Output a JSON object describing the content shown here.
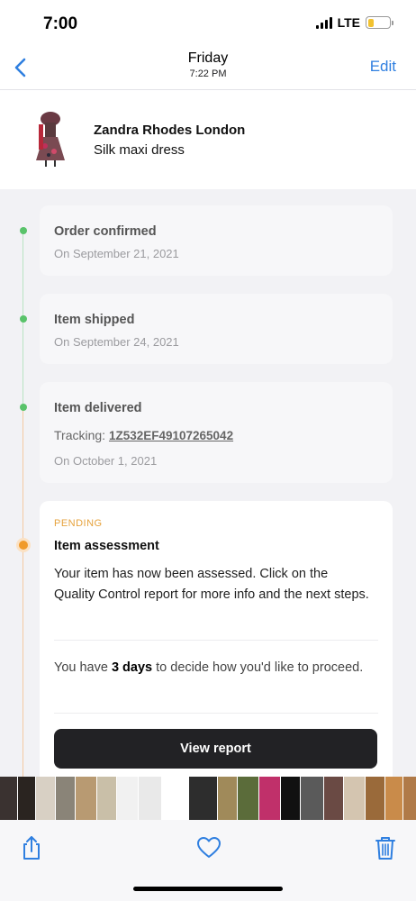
{
  "status_bar": {
    "time": "7:00",
    "network": "LTE"
  },
  "nav": {
    "title": "Friday",
    "subtitle": "7:22 PM",
    "edit_label": "Edit"
  },
  "product": {
    "brand": "Zandra Rhodes London",
    "name": "Silk maxi dress"
  },
  "timeline": {
    "order_confirmed": {
      "title": "Order confirmed",
      "date": "On September 21, 2021"
    },
    "item_shipped": {
      "title": "Item shipped",
      "date": "On September 24, 2021"
    },
    "item_delivered": {
      "title": "Item delivered",
      "tracking_label": "Tracking:",
      "tracking_number": "1Z532EF49107265042",
      "date": "On October 1, 2021"
    },
    "assessment": {
      "status": "PENDING",
      "title": "Item assessment",
      "body": "Your item has now been assessed. Click on the Quality Control report for more info and the next steps.",
      "decision_prefix": "You have ",
      "decision_days": "3 days",
      "decision_suffix": " to decide how you'd like to proceed.",
      "button_label": "View report"
    }
  },
  "colors": {
    "accent": "#2f7fe0",
    "completed": "#59c36a",
    "pending": "#f09a2a",
    "button": "#222225"
  },
  "thumbnails": [
    "#3a3230",
    "#2a2420",
    "#d8d0c4",
    "#8a8478",
    "#b89a72",
    "#c9bfa8",
    "#f1f1f1",
    "#e9e9e9",
    "#ffffff",
    "#2d2d2d",
    "#a08a5a",
    "#5b6c3a",
    "#c0306a",
    "#111111",
    "#5a5a5a",
    "#6a4a44",
    "#d4c5b0",
    "#9a6a3a",
    "#c98b4a",
    "#b07a48"
  ],
  "toolbar": {
    "share": "share-icon",
    "favorite": "heart-icon",
    "delete": "trash-icon"
  }
}
